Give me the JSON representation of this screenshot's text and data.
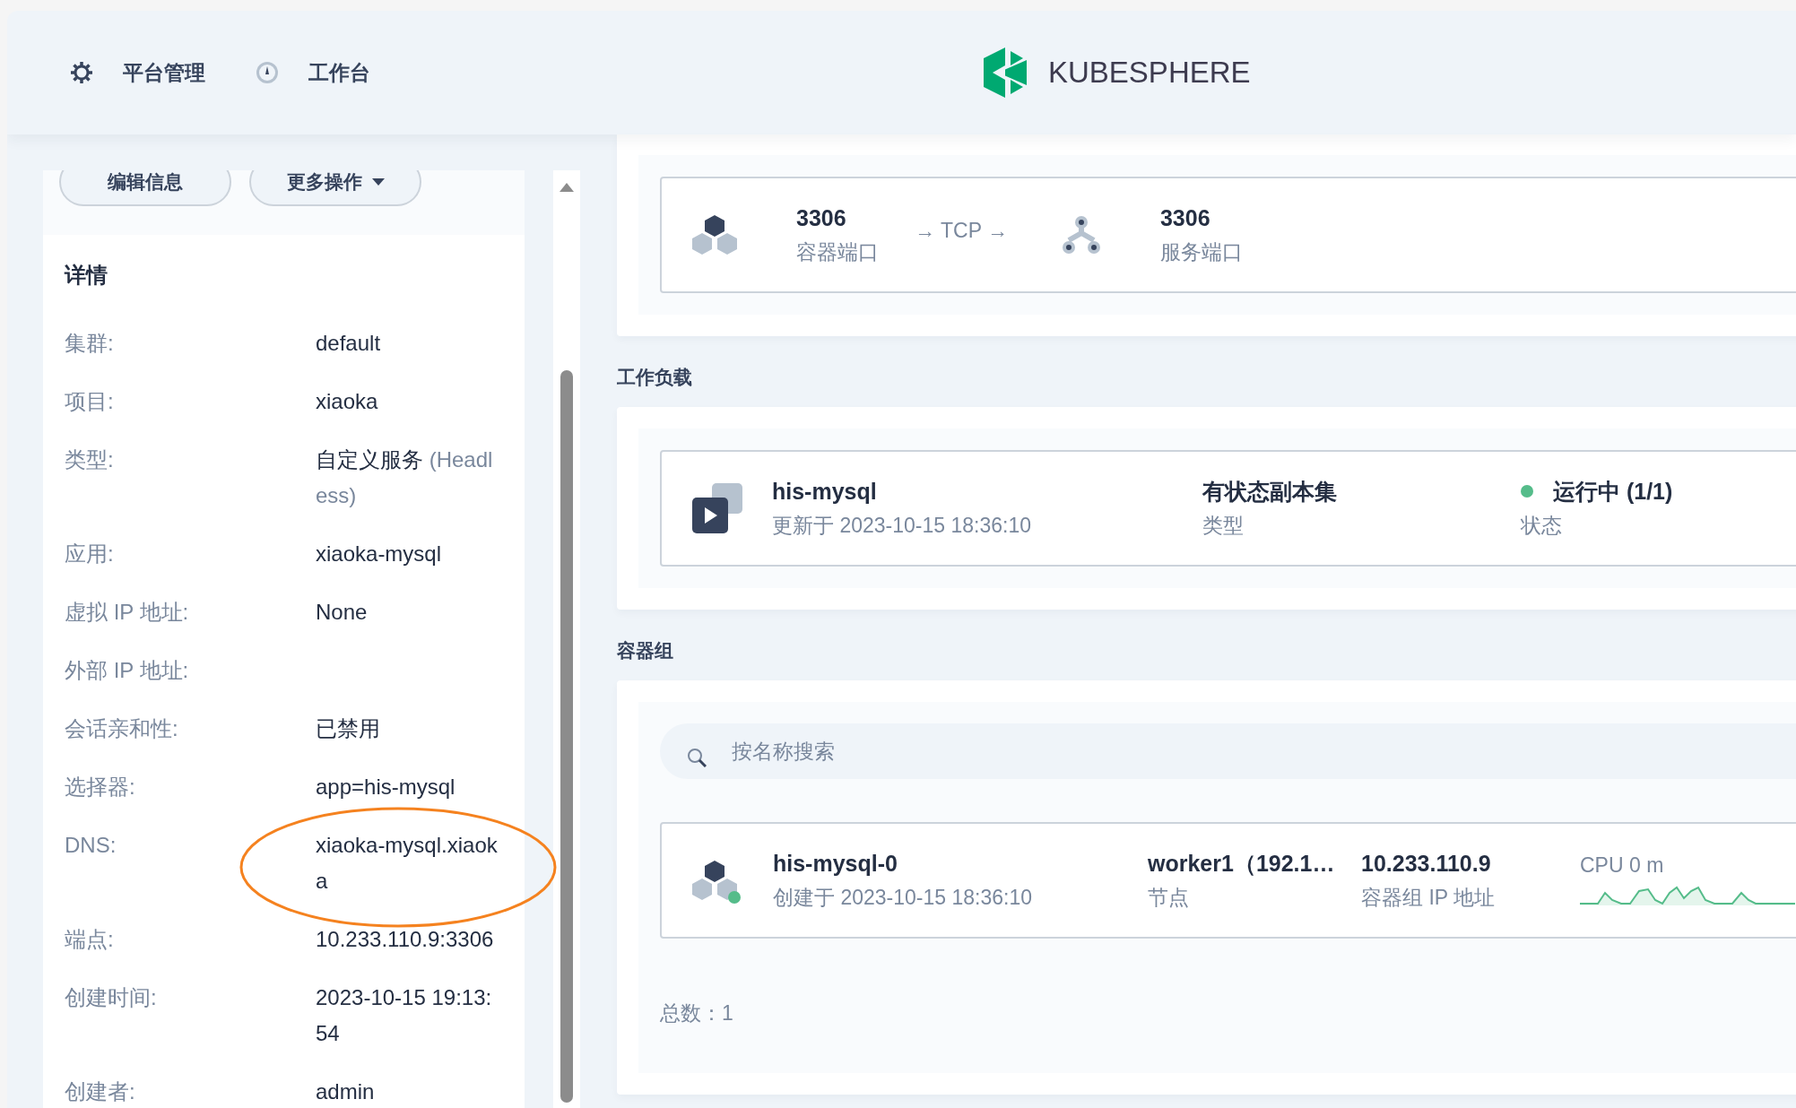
{
  "nav": [
    {
      "label": "平台管理"
    },
    {
      "label": "工作台"
    }
  ],
  "logo": {
    "text": "KUBESPHERE"
  },
  "actions": [
    {
      "label": "编辑信息",
      "dropdown": false
    },
    {
      "label": "更多操作",
      "dropdown": true
    }
  ],
  "details": {
    "title": "详情",
    "rows": [
      {
        "label": "集群:",
        "value": "default"
      },
      {
        "label": "项目:",
        "value": "xiaoka"
      },
      {
        "label": "类型:",
        "value": "自定义服务",
        "note": "(Headless)"
      },
      {
        "label": "应用:",
        "value": "xiaoka-mysql"
      },
      {
        "label": "虚拟 IP 地址:",
        "value": "None"
      },
      {
        "label": "外部 IP 地址:"
      },
      {
        "label": "会话亲和性:",
        "value": "已禁用"
      },
      {
        "label": "选择器:",
        "value": "app=his-mysql"
      },
      {
        "label": "DNS:",
        "value": "xiaoka-mysql.xiaoka",
        "circled": true
      },
      {
        "label": "端点:",
        "value": "10.233.110.9:3306"
      },
      {
        "label": "创建时间:",
        "value": "2023-10-15 19:13:54"
      },
      {
        "label": "创建者:",
        "value": "admin"
      }
    ]
  },
  "ports": {
    "container_port": "3306",
    "container_label": "容器端口",
    "protocol": "→ TCP →",
    "service_port": "3306",
    "service_label": "服务端口"
  },
  "workloads": {
    "title": "工作负载",
    "items": [
      {
        "name": "his-mysql",
        "updated": "更新于 2023-10-15 18:36:10",
        "type": "有状态副本集",
        "type_label": "类型",
        "status": "运行中 (1/1)",
        "status_label": "状态",
        "healthy": true
      }
    ]
  },
  "pods": {
    "title": "容器组",
    "search": {
      "placeholder": "按名称搜索"
    },
    "items": [
      {
        "name": "his-mysql-0",
        "created": "创建于 2023-10-15 18:36:10",
        "node": "worker1（192.1…",
        "node_label": "节点",
        "ip": "10.233.110.9",
        "ip_label": "容器组 IP 地址",
        "cpu": "CPU 0 m",
        "healthy": true
      }
    ],
    "total": "总数：1"
  }
}
